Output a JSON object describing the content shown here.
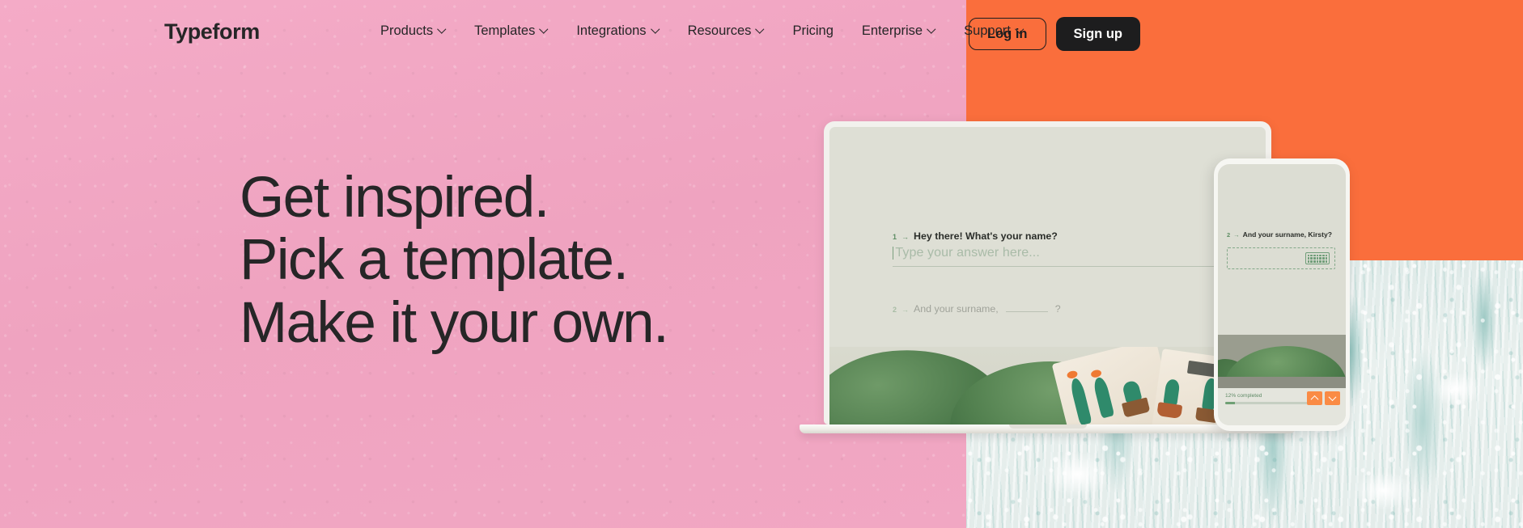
{
  "header": {
    "logo": "Typeform",
    "nav": [
      {
        "label": "Products",
        "has_chevron": true
      },
      {
        "label": "Templates",
        "has_chevron": true
      },
      {
        "label": "Integrations",
        "has_chevron": true
      },
      {
        "label": "Resources",
        "has_chevron": true
      },
      {
        "label": "Pricing",
        "has_chevron": false
      },
      {
        "label": "Enterprise",
        "has_chevron": true
      },
      {
        "label": "Support",
        "has_chevron": true
      }
    ],
    "login_label": "Log in",
    "signup_label": "Sign up"
  },
  "hero": {
    "line1": "Get inspired.",
    "line2": "Pick a template.",
    "line3": "Make it your own."
  },
  "laptop": {
    "question1": {
      "number": "1",
      "arrow": "→",
      "text": "Hey there! What's your name?",
      "placeholder": "Type your answer here..."
    },
    "question2": {
      "number": "2",
      "arrow": "→",
      "text_before": "And your surname,",
      "text_after": "?"
    }
  },
  "phone": {
    "question": {
      "number": "2",
      "arrow": "→",
      "text": "And your surname, Kirsty?"
    },
    "keyboard_icon": "keyboard-icon",
    "progress_label": "12% completed",
    "progress_percent": 12,
    "prev_label": "⌃",
    "next_label": "⌄"
  },
  "colors": {
    "pink": "#f0a5c0",
    "orange": "#fa6e3c",
    "dark": "#1d1d1e",
    "texture_teal": "#9fc9c5",
    "form_green": "#5d8d63"
  }
}
